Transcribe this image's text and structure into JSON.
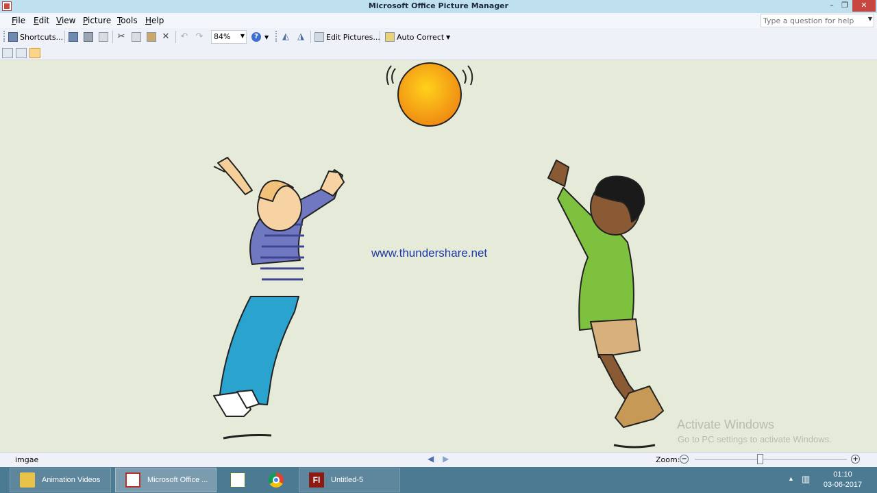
{
  "window": {
    "title": "Microsoft Office Picture Manager",
    "controls": {
      "minimize": "–",
      "restore": "❐",
      "close": "✕"
    }
  },
  "menu": [
    "File",
    "Edit",
    "View",
    "Picture",
    "Tools",
    "Help"
  ],
  "help_box": {
    "placeholder": "Type a question for help"
  },
  "toolbar": {
    "shortcuts_label": "Shortcuts...",
    "zoom_value": "84%",
    "edit_pictures_label": "Edit Pictures...",
    "auto_correct_label": "Auto Correct"
  },
  "picture": {
    "watermark_url": "www.thundershare.net",
    "activate_title": "Activate Windows",
    "activate_sub": "Go to PC settings to activate Windows."
  },
  "status": {
    "file_name": "imgae",
    "zoom_label": "Zoom:",
    "zoom_level": 0.43
  },
  "taskbar": {
    "items": [
      {
        "label": "Animation Videos",
        "icon": "folder-icon"
      },
      {
        "label": "Microsoft Office ...",
        "icon": "picture-manager-icon"
      },
      {
        "label": "",
        "icon": "chart-icon"
      },
      {
        "label": "",
        "icon": "chrome-icon"
      },
      {
        "label": "Untitled-5",
        "icon": "flash-icon"
      }
    ],
    "clock_time": "01:10",
    "clock_date": "03-06-2017"
  },
  "colors": {
    "titlebar": "#bfe0ee",
    "canvas": "#e6ead8",
    "taskbar": "#4c7a92",
    "link": "#1a3aa8"
  }
}
